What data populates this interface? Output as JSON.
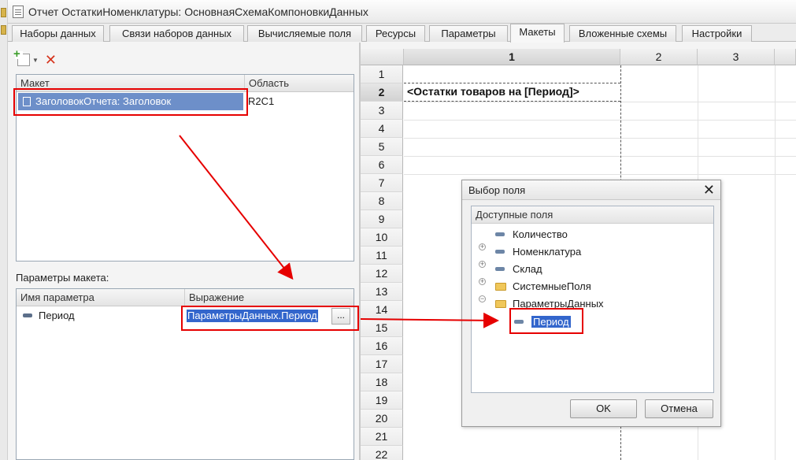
{
  "window": {
    "title": "Отчет ОстаткиНоменклатуры: ОсновнаяСхемаКомпоновкиДанных"
  },
  "tabs": [
    {
      "label": "Наборы данных",
      "active": false
    },
    {
      "label": "Связи наборов данных",
      "active": false
    },
    {
      "label": "Вычисляемые поля",
      "active": false
    },
    {
      "label": "Ресурсы",
      "active": false
    },
    {
      "label": "Параметры",
      "active": false
    },
    {
      "label": "Макеты",
      "active": true
    },
    {
      "label": "Вложенные схемы",
      "active": false
    },
    {
      "label": "Настройки",
      "active": false
    }
  ],
  "layouts_table": {
    "columns": [
      "Макет",
      "Область"
    ],
    "rows": [
      {
        "name": "ЗаголовокОтчета: Заголовок",
        "area": "R2C1"
      }
    ]
  },
  "params": {
    "label": "Параметры макета:",
    "columns": [
      "Имя параметра",
      "Выражение"
    ],
    "rows": [
      {
        "name": "Период",
        "expression": "ПараметрыДанных.Период",
        "button": "..."
      }
    ]
  },
  "sheet": {
    "columns": [
      "1",
      "2",
      "3"
    ],
    "rows": [
      "1",
      "2",
      "3",
      "4",
      "5",
      "6",
      "7",
      "8",
      "9",
      "10",
      "11",
      "12",
      "13",
      "14",
      "15",
      "16",
      "17",
      "18",
      "19",
      "20",
      "21",
      "22"
    ],
    "cell_text": "<Остатки товаров на [Период]>"
  },
  "dialog": {
    "title": "Выбор поля",
    "close": "✕",
    "tree_header": "Доступные поля",
    "items": [
      {
        "label": "Количество"
      },
      {
        "label": "Номенклатура",
        "expander": "+"
      },
      {
        "label": "Склад",
        "expander": "+"
      },
      {
        "label": "СистемныеПоля",
        "expander": "+"
      },
      {
        "label": "ПараметрыДанных",
        "expander": "−"
      },
      {
        "label": "Период"
      }
    ],
    "ok": "OK",
    "cancel": "Отмена"
  },
  "colors": {
    "selection": "#3366cc",
    "row_selection": "#6d8fc9",
    "highlight_box": "#e60000",
    "arrow": "#e60000"
  },
  "icons": [
    "add-icon",
    "delete-icon",
    "layout-icon",
    "field-icon",
    "folder-icon",
    "close-icon"
  ]
}
